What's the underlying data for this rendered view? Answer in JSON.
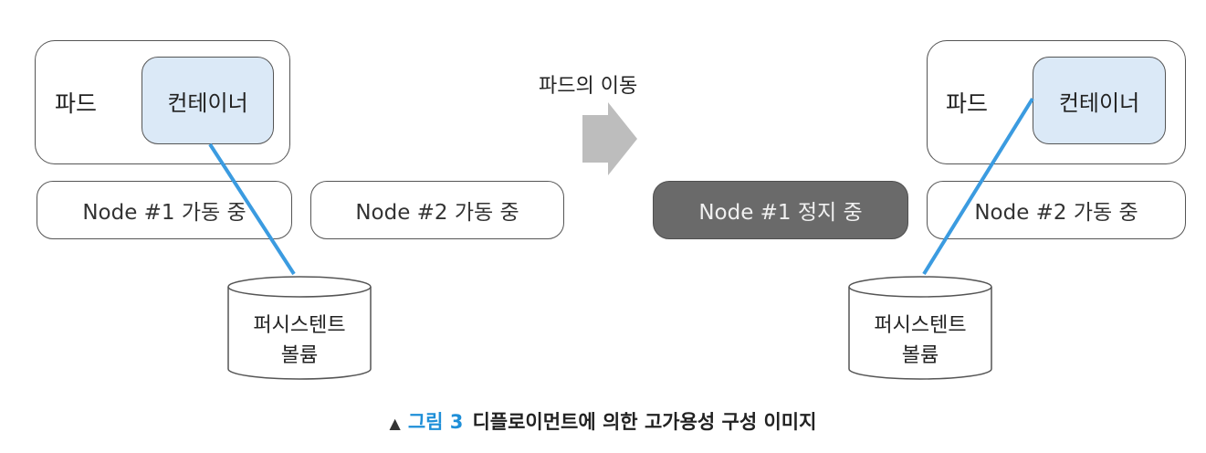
{
  "left": {
    "pod_label": "파드",
    "container_label": "컨테이너",
    "node1": "Node #1 가동 중",
    "node2": "Node #2 가동 중",
    "volume_line1": "퍼시스텐트",
    "volume_line2": "볼륨"
  },
  "transition": {
    "label": "파드의 이동",
    "arrow_icon": "right-arrow-icon"
  },
  "right": {
    "pod_label": "파드",
    "container_label": "컨테이너",
    "node1": "Node #1 정지 중",
    "node2": "Node #2 가동 중",
    "volume_line1": "퍼시스텐트",
    "volume_line2": "볼륨"
  },
  "caption": {
    "marker": "▲",
    "figure": "그림 3",
    "text": "디플로이먼트에 의한 고가용성 구성 이미지"
  },
  "colors": {
    "container_fill": "#dbe9f7",
    "link_line": "#3b9be0",
    "stopped_node": "#6a6a6a",
    "arrow": "#bdbdbd",
    "caption_accent": "#1f8fd8"
  }
}
